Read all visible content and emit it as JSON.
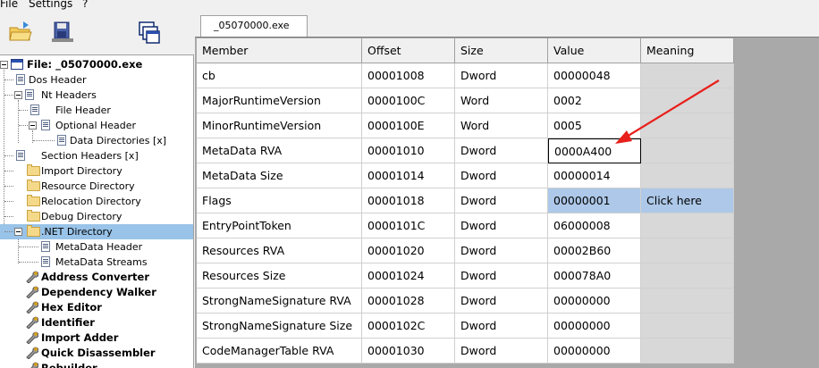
{
  "menu": {
    "file": "File",
    "settings": "Settings",
    "help": "?"
  },
  "toolbar": {
    "open_icon": "folder-open-icon",
    "save_icon": "save-icon",
    "windows_icon": "windows-icon"
  },
  "tab": {
    "label": "_05070000.exe"
  },
  "tree": {
    "root": "File: _05070000.exe",
    "items": [
      {
        "label": "Dos Header"
      },
      {
        "label": "Nt Headers"
      },
      {
        "label": "File Header"
      },
      {
        "label": "Optional Header"
      },
      {
        "label": "Data Directories [x]"
      },
      {
        "label": "Section Headers [x]"
      },
      {
        "label": "Import Directory"
      },
      {
        "label": "Resource Directory"
      },
      {
        "label": "Relocation Directory"
      },
      {
        "label": "Debug Directory"
      },
      {
        "label": ".NET Directory"
      },
      {
        "label": "MetaData Header"
      },
      {
        "label": "MetaData Streams"
      },
      {
        "label": "Address Converter"
      },
      {
        "label": "Dependency Walker"
      },
      {
        "label": "Hex Editor"
      },
      {
        "label": "Identifier"
      },
      {
        "label": "Import Adder"
      },
      {
        "label": "Quick Disassembler"
      },
      {
        "label": "Rebuilder"
      }
    ]
  },
  "table": {
    "headers": [
      "Member",
      "Offset",
      "Size",
      "Value",
      "Meaning"
    ],
    "rows": [
      [
        "cb",
        "00001008",
        "Dword",
        "00000048",
        ""
      ],
      [
        "MajorRuntimeVersion",
        "0000100C",
        "Word",
        "0002",
        ""
      ],
      [
        "MinorRuntimeVersion",
        "0000100E",
        "Word",
        "0005",
        ""
      ],
      [
        "MetaData RVA",
        "00001010",
        "Dword",
        "0000A400",
        ""
      ],
      [
        "MetaData Size",
        "00001014",
        "Dword",
        "00000014",
        ""
      ],
      [
        "Flags",
        "00001018",
        "Dword",
        "00000001",
        "Click here"
      ],
      [
        "EntryPointToken",
        "0000101C",
        "Dword",
        "06000008",
        ""
      ],
      [
        "Resources RVA",
        "00001020",
        "Dword",
        "00002B60",
        ""
      ],
      [
        "Resources Size",
        "00001024",
        "Dword",
        "000078A0",
        ""
      ],
      [
        "StrongNameSignature RVA",
        "00001028",
        "Dword",
        "00000000",
        ""
      ],
      [
        "StrongNameSignature Size",
        "0000102C",
        "Dword",
        "00000000",
        ""
      ],
      [
        "CodeManagerTable RVA",
        "00001030",
        "Dword",
        "00000000",
        ""
      ]
    ]
  },
  "colors": {
    "selection": "#99c3e8",
    "row_highlight": "#adc8e8",
    "annotation_arrow": "#e8201c"
  }
}
